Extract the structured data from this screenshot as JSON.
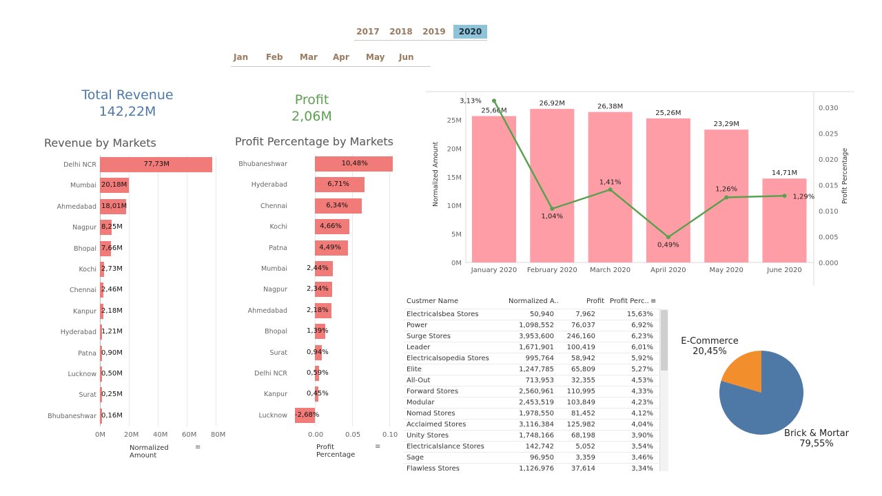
{
  "filters": {
    "years": [
      {
        "label": "2017",
        "selected": false
      },
      {
        "label": "2018",
        "selected": false
      },
      {
        "label": "2019",
        "selected": false
      },
      {
        "label": "2020",
        "selected": true
      }
    ],
    "months": [
      "Jan",
      "Feb",
      "Mar",
      "Apr",
      "May",
      "Jun"
    ]
  },
  "kpis": {
    "revenue": {
      "title": "Total Revenue",
      "value": "142,22M",
      "color": "#4e79a7"
    },
    "profit": {
      "title": "Profit",
      "value": "2,06M",
      "color": "#59a14f"
    }
  },
  "revenue_by_markets": {
    "title": "Revenue by Markets",
    "axis_title": "Normalized Amount",
    "ticks": [
      "0M",
      "20M",
      "40M",
      "60M",
      "80M"
    ],
    "rows": [
      {
        "market": "Delhi NCR",
        "value": 77.73,
        "label": "77,73M"
      },
      {
        "market": "Mumbai",
        "value": 20.18,
        "label": "20,18M"
      },
      {
        "market": "Ahmedabad",
        "value": 18.01,
        "label": "18,01M"
      },
      {
        "market": "Nagpur",
        "value": 8.25,
        "label": "8,25M"
      },
      {
        "market": "Bhopal",
        "value": 7.66,
        "label": "7,66M"
      },
      {
        "market": "Kochi",
        "value": 2.73,
        "label": "2,73M"
      },
      {
        "market": "Chennai",
        "value": 2.46,
        "label": "2,46M"
      },
      {
        "market": "Kanpur",
        "value": 2.18,
        "label": "2,18M"
      },
      {
        "market": "Hyderabad",
        "value": 1.21,
        "label": "1,21M"
      },
      {
        "market": "Patna",
        "value": 0.9,
        "label": "0,90M"
      },
      {
        "market": "Lucknow",
        "value": 0.5,
        "label": "0,50M"
      },
      {
        "market": "Surat",
        "value": 0.25,
        "label": "0,25M"
      },
      {
        "market": "Bhubaneshwar",
        "value": 0.16,
        "label": "0,16M"
      }
    ]
  },
  "profit_by_markets": {
    "title": "Profit Percentage by Markets",
    "axis_title": "Profit Percentage",
    "ticks": [
      "0.00",
      "0.05",
      "0.10"
    ],
    "rows": [
      {
        "market": "Bhubaneshwar",
        "value": 0.1048,
        "label": "10,48%"
      },
      {
        "market": "Hyderabad",
        "value": 0.0671,
        "label": "6,71%"
      },
      {
        "market": "Chennai",
        "value": 0.0634,
        "label": "6,34%"
      },
      {
        "market": "Kochi",
        "value": 0.0466,
        "label": "4,66%"
      },
      {
        "market": "Patna",
        "value": 0.0449,
        "label": "4,49%"
      },
      {
        "market": "Mumbai",
        "value": 0.0244,
        "label": "2,44%"
      },
      {
        "market": "Nagpur",
        "value": 0.0234,
        "label": "2,34%"
      },
      {
        "market": "Ahmedabad",
        "value": 0.0218,
        "label": "2,18%"
      },
      {
        "market": "Bhopal",
        "value": 0.0139,
        "label": "1,39%"
      },
      {
        "market": "Surat",
        "value": 0.0094,
        "label": "0,94%"
      },
      {
        "market": "Delhi NCR",
        "value": 0.0059,
        "label": "0,59%"
      },
      {
        "market": "Kanpur",
        "value": 0.0045,
        "label": "0,45%"
      },
      {
        "market": "Lucknow",
        "value": -0.0268,
        "label": "-2,68%"
      }
    ]
  },
  "combo_chart": {
    "left_axis_title": "Normalized Amount",
    "right_axis_title": "Profit Percentage",
    "left_ticks": [
      "0M",
      "5M",
      "10M",
      "15M",
      "20M",
      "25M"
    ],
    "right_ticks": [
      "0.000",
      "0.005",
      "0.010",
      "0.015",
      "0.020",
      "0.025",
      "0.030"
    ],
    "points": [
      {
        "month": "January 2020",
        "amount": 25.66,
        "amount_label": "25,66M",
        "pct": 0.0313,
        "pct_label": "3,13%"
      },
      {
        "month": "February 2020",
        "amount": 26.92,
        "amount_label": "26,92M",
        "pct": 0.0104,
        "pct_label": "1,04%"
      },
      {
        "month": "March 2020",
        "amount": 26.38,
        "amount_label": "26,38M",
        "pct": 0.0141,
        "pct_label": "1,41%"
      },
      {
        "month": "April 2020",
        "amount": 25.26,
        "amount_label": "25,26M",
        "pct": 0.0049,
        "pct_label": "0,49%"
      },
      {
        "month": "May 2020",
        "amount": 23.29,
        "amount_label": "23,29M",
        "pct": 0.0126,
        "pct_label": "1,26%"
      },
      {
        "month": "June 2020",
        "amount": 14.71,
        "amount_label": "14,71M",
        "pct": 0.0129,
        "pct_label": "1,29%"
      }
    ]
  },
  "customer_table": {
    "headers": [
      "Custmer Name",
      "Normalized A..",
      "Profit",
      "Profit Perc.."
    ],
    "rows": [
      [
        "Electricalsbea Stores",
        "50,940",
        "7,962",
        "15,63%"
      ],
      [
        "Power",
        "1,098,552",
        "76,037",
        "6,92%"
      ],
      [
        "Surge Stores",
        "3,953,600",
        "246,160",
        "6,23%"
      ],
      [
        "Leader",
        "1,671,901",
        "100,419",
        "6,01%"
      ],
      [
        "Electricalsopedia Stores",
        "995,764",
        "58,942",
        "5,92%"
      ],
      [
        "Elite",
        "1,247,785",
        "65,809",
        "5,27%"
      ],
      [
        "All-Out",
        "713,953",
        "32,355",
        "4,53%"
      ],
      [
        "Forward Stores",
        "2,560,961",
        "110,995",
        "4,33%"
      ],
      [
        "Modular",
        "2,453,519",
        "103,849",
        "4,23%"
      ],
      [
        "Nomad Stores",
        "1,978,550",
        "81,452",
        "4,12%"
      ],
      [
        "Acclaimed Stores",
        "3,116,384",
        "125,982",
        "4,04%"
      ],
      [
        "Unity Stores",
        "1,748,166",
        "68,198",
        "3,90%"
      ],
      [
        "Electricalslance Stores",
        "142,742",
        "5,052",
        "3,54%"
      ],
      [
        "Sage",
        "96,950",
        "3,359",
        "3,46%"
      ],
      [
        "Flawless Stores",
        "1,126,976",
        "37,614",
        "3,34%"
      ]
    ]
  },
  "pie": {
    "slices": [
      {
        "name": "E-Commerce",
        "pct": 0.2045,
        "label": "20,45%",
        "color": "#f28e2b"
      },
      {
        "name": "Brick & Mortar",
        "pct": 0.7955,
        "label": "79,55%",
        "color": "#4e79a7"
      }
    ]
  },
  "chart_data": [
    {
      "type": "bar",
      "title": "Revenue by Markets",
      "xlabel": "Normalized Amount",
      "ylabel": "",
      "xlim": [
        0,
        80
      ],
      "categories": [
        "Delhi NCR",
        "Mumbai",
        "Ahmedabad",
        "Nagpur",
        "Bhopal",
        "Kochi",
        "Chennai",
        "Kanpur",
        "Hyderabad",
        "Patna",
        "Lucknow",
        "Surat",
        "Bhubaneshwar"
      ],
      "values": [
        77.73,
        20.18,
        18.01,
        8.25,
        7.66,
        2.73,
        2.46,
        2.18,
        1.21,
        0.9,
        0.5,
        0.25,
        0.16
      ]
    },
    {
      "type": "bar",
      "title": "Profit Percentage by Markets",
      "xlabel": "Profit Percentage",
      "ylabel": "",
      "xlim": [
        -0.03,
        0.11
      ],
      "categories": [
        "Bhubaneshwar",
        "Hyderabad",
        "Chennai",
        "Kochi",
        "Patna",
        "Mumbai",
        "Nagpur",
        "Ahmedabad",
        "Bhopal",
        "Surat",
        "Delhi NCR",
        "Kanpur",
        "Lucknow"
      ],
      "values": [
        0.1048,
        0.0671,
        0.0634,
        0.0466,
        0.0449,
        0.0244,
        0.0234,
        0.0218,
        0.0139,
        0.0094,
        0.0059,
        0.0045,
        -0.0268
      ]
    },
    {
      "type": "bar",
      "title": "",
      "xlabel": "",
      "ylabel": "Normalized Amount",
      "ylim": [
        0,
        28
      ],
      "categories": [
        "January 2020",
        "February 2020",
        "March 2020",
        "April 2020",
        "May 2020",
        "June 2020"
      ],
      "series": [
        {
          "name": "Normalized Amount",
          "type": "bar",
          "values": [
            25.66,
            26.92,
            26.38,
            25.26,
            23.29,
            14.71
          ]
        },
        {
          "name": "Profit Percentage",
          "type": "line",
          "axis": "right",
          "values": [
            0.0313,
            0.0104,
            0.0141,
            0.0049,
            0.0126,
            0.0129
          ]
        }
      ]
    },
    {
      "type": "pie",
      "title": "",
      "categories": [
        "E-Commerce",
        "Brick & Mortar"
      ],
      "values": [
        20.45,
        79.55
      ]
    }
  ]
}
